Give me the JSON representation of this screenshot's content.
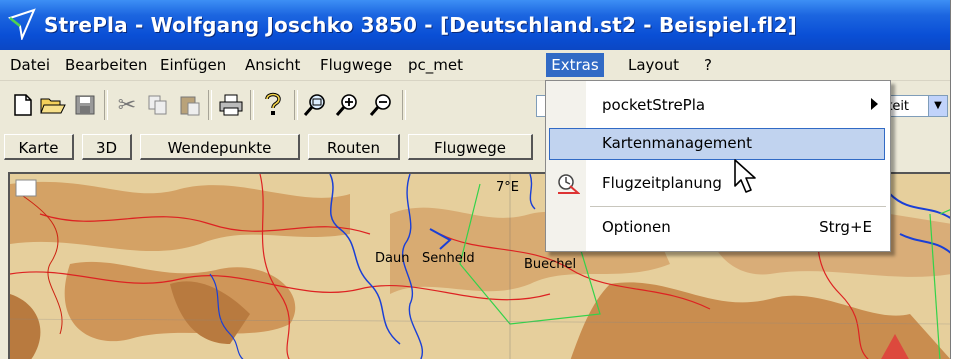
{
  "window": {
    "title": "StrePla - Wolfgang Joschko 3850 - [Deutschland.st2 - Beispiel.fl2]"
  },
  "menubar": {
    "items": [
      "Datei",
      "Bearbeiten",
      "Einfügen",
      "Ansicht",
      "Flugwege",
      "pc_met",
      "Extras",
      "Layout",
      "?"
    ]
  },
  "toolbar": {
    "buttons": [
      "new-file-icon",
      "open-folder-icon",
      "save-icon",
      "cut-icon",
      "copy-icon",
      "paste-icon",
      "print-icon",
      "help-icon",
      "zoom-region-icon",
      "zoom-in-icon",
      "zoom-out-icon"
    ],
    "combo_value": "gkeit"
  },
  "tabs": [
    "Karte",
    "3D",
    "Wendepunkte",
    "Routen",
    "Flugwege"
  ],
  "extras_menu": {
    "items": [
      {
        "label": "pocketStrePla",
        "submenu": true
      },
      {
        "label": "Kartenmanagement",
        "highlighted": true
      },
      {
        "label": "Flugzeitplanung",
        "icon": "clock-icon"
      },
      {
        "label": "Optionen",
        "shortcut": "Strg+E"
      }
    ]
  },
  "map": {
    "grid_label": "7°E",
    "places": [
      "Daun",
      "Senheld",
      "Buechel"
    ]
  },
  "colors": {
    "titlebar": "#0a4fd6",
    "menu_highlight": "#316ac5",
    "item_hover": "#c1d3ef",
    "terrain": "#e8d4a8"
  }
}
